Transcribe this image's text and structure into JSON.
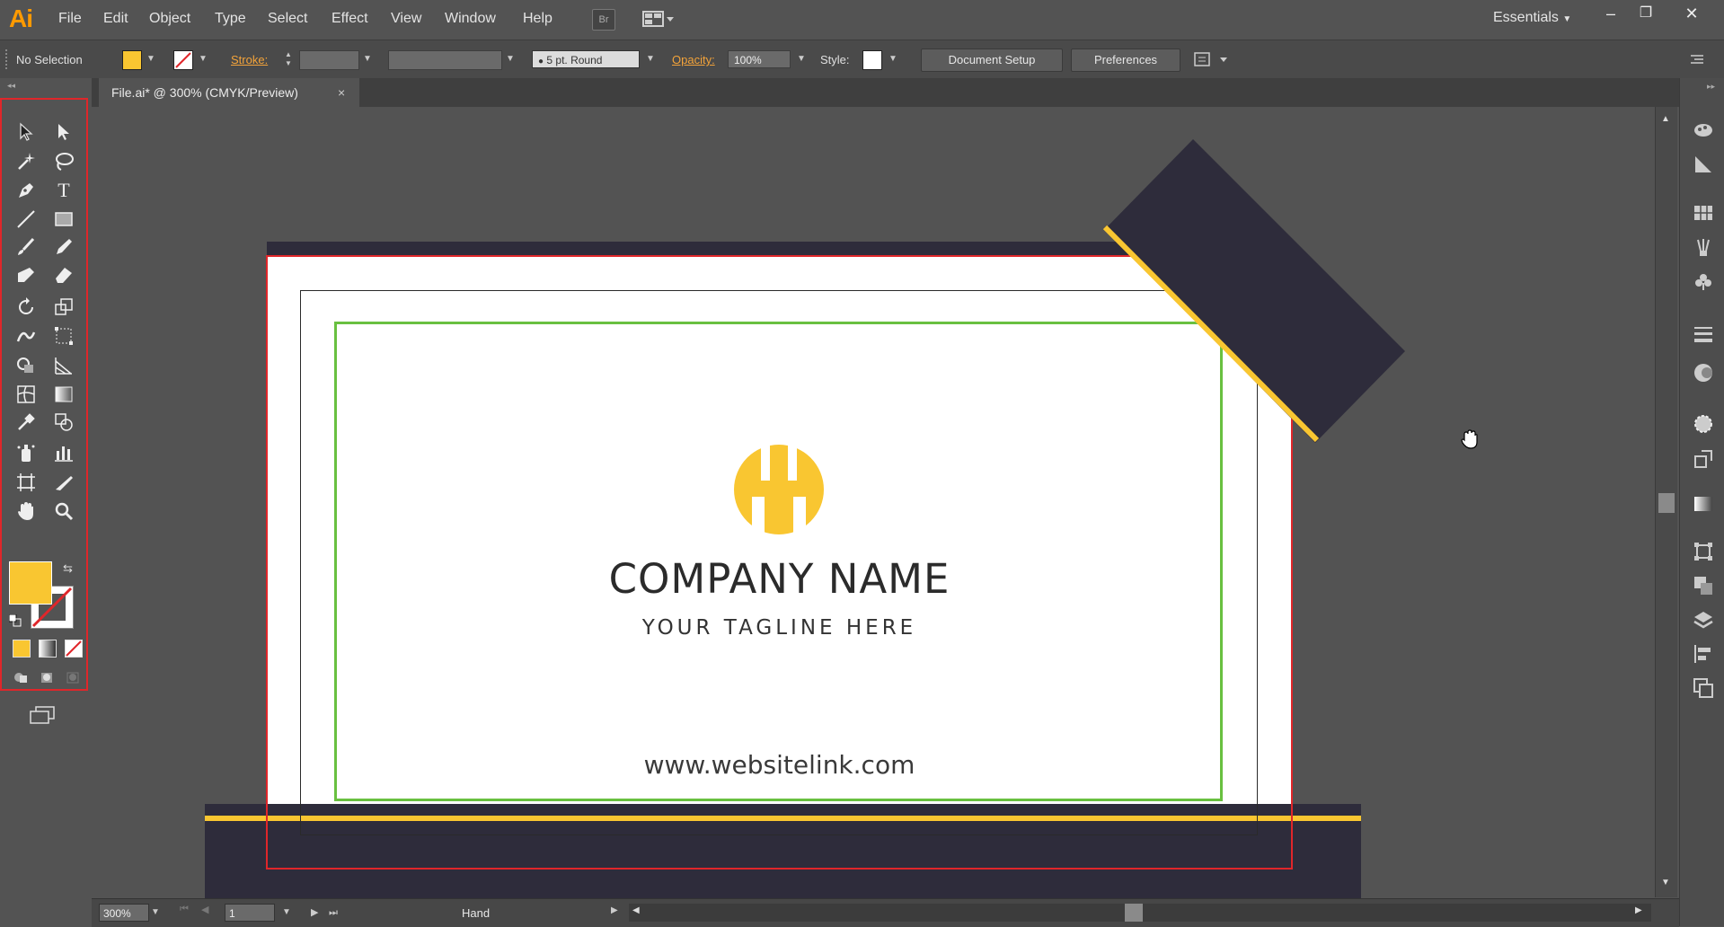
{
  "app": {
    "logo": "Ai"
  },
  "menu": [
    "File",
    "Edit",
    "Object",
    "Type",
    "Select",
    "Effect",
    "View",
    "Window",
    "Help"
  ],
  "bridge_label": "Br",
  "workspace": "Essentials",
  "window_controls": [
    "–",
    "❐",
    "✕"
  ],
  "control_bar": {
    "selection": "No Selection",
    "stroke_label": "Stroke:",
    "brush_value": "5 pt. Round",
    "opacity_label": "Opacity:",
    "opacity_value": "100%",
    "style_label": "Style:",
    "document_setup": "Document Setup",
    "preferences": "Preferences"
  },
  "colors": {
    "accent": "#f9c631",
    "dark": "#2e2c3b",
    "trim": "#e0262a",
    "safe": "#69c040"
  },
  "document_tab": {
    "title": "File.ai* @ 300% (CMYK/Preview)",
    "close": "×"
  },
  "card": {
    "company_name": "COMPANY NAME",
    "tagline": "YOUR TAGLINE HERE",
    "website": "www.websitelink.com"
  },
  "status": {
    "zoom": "300%",
    "artboard": "1",
    "tool": "Hand"
  },
  "tools": [
    "selection",
    "direct-selection",
    "magic-wand",
    "lasso",
    "pen",
    "type",
    "line",
    "rectangle",
    "paintbrush",
    "pencil",
    "blob-brush",
    "eraser",
    "rotate",
    "scale",
    "warp",
    "free-transform",
    "shape-builder",
    "perspective-grid",
    "mesh",
    "gradient",
    "eyedropper",
    "blend",
    "symbol-sprayer",
    "column-graph",
    "artboard",
    "slice",
    "hand",
    "zoom"
  ],
  "right_panel_icons": [
    "color-guide-icon",
    "color-icon",
    "swatches-icon",
    "brushes-icon",
    "symbols-icon",
    "stroke-icon",
    "transparency-icon",
    "appearance-icon",
    "graphic-styles-icon",
    "gradient-icon",
    "transform-icon",
    "pathfinder-icon",
    "layers-icon",
    "align-icon",
    "artboards-icon"
  ]
}
